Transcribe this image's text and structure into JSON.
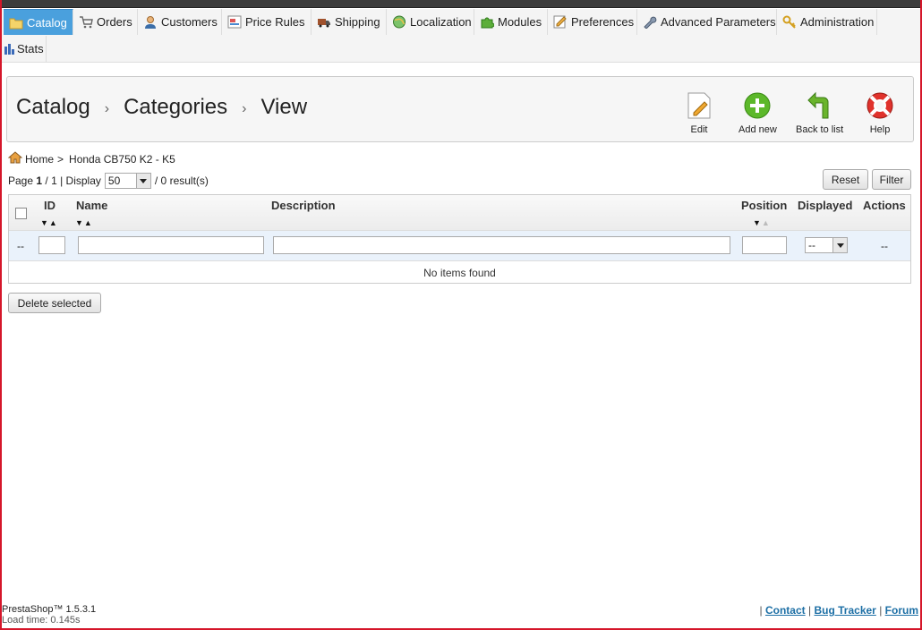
{
  "nav": {
    "tabs": [
      {
        "label": "Catalog",
        "icon": "folder-icon",
        "active": true
      },
      {
        "label": "Orders",
        "icon": "cart-icon"
      },
      {
        "label": "Customers",
        "icon": "user-icon"
      },
      {
        "label": "Price Rules",
        "icon": "price-tag-icon"
      },
      {
        "label": "Shipping",
        "icon": "truck-icon"
      },
      {
        "label": "Localization",
        "icon": "globe-icon"
      },
      {
        "label": "Modules",
        "icon": "puzzle-icon"
      },
      {
        "label": "Preferences",
        "icon": "preferences-icon"
      },
      {
        "label": "Advanced Parameters",
        "icon": "wrench-icon"
      },
      {
        "label": "Administration",
        "icon": "key-icon"
      },
      {
        "label": "Stats",
        "icon": "bar-chart-icon"
      }
    ]
  },
  "header": {
    "breadcrumb": [
      "Catalog",
      "Categories",
      "View"
    ],
    "separator": "›",
    "toolbar": {
      "edit": "Edit",
      "add_new": "Add new",
      "back": "Back to list",
      "help": "Help"
    }
  },
  "path": {
    "home": "Home",
    "sep": ">",
    "current": "Honda CB750 K2 - K5"
  },
  "pager": {
    "page_prefix": "Page",
    "page_current": "1",
    "page_total": "/ 1 | Display",
    "per_page": "50",
    "results": "/ 0 result(s)"
  },
  "actions": {
    "reset": "Reset",
    "filter": "Filter",
    "delete_selected": "Delete selected"
  },
  "table": {
    "columns": [
      "ID",
      "Name",
      "Description",
      "Position",
      "Displayed",
      "Actions"
    ],
    "filter_placeholder_dash": "--",
    "displayed_select": "--",
    "actions_dash": "--",
    "empty": "No items found"
  },
  "footer": {
    "version": "PrestaShop™ 1.5.3.1",
    "load_time": "Load time: 0.145s",
    "links": [
      "Contact",
      "Bug Tracker",
      "Forum"
    ],
    "link_sep": "|"
  },
  "colors": {
    "active_tab": "#4aa0dd",
    "frame": "#d5162a",
    "add_green": "#5cb82a",
    "help_red": "#e0322c"
  }
}
